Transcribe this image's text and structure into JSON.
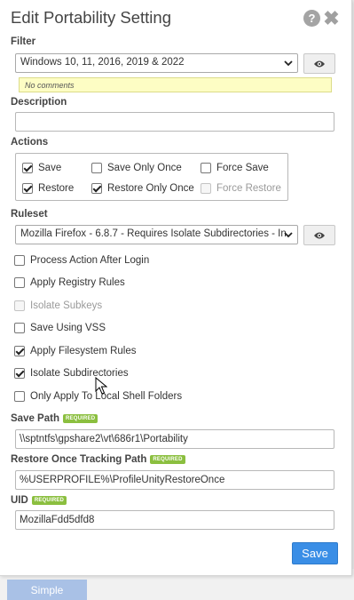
{
  "dialog": {
    "title": "Edit Portability Setting",
    "help_icon": "question-circle-icon",
    "close_icon": "close-icon",
    "help_glyph": "?",
    "close_glyph": "✖"
  },
  "filter": {
    "label": "Filter",
    "selected": "Windows 10, 11, 2016, 2019 & 2022",
    "comment": "No comments"
  },
  "description": {
    "label": "Description",
    "value": ""
  },
  "actions": {
    "label": "Actions",
    "items": [
      {
        "label": "Save",
        "checked": true,
        "disabled": false
      },
      {
        "label": "Save Only Once",
        "checked": false,
        "disabled": false
      },
      {
        "label": "Force Save",
        "checked": false,
        "disabled": false
      },
      {
        "label": "Restore",
        "checked": true,
        "disabled": false
      },
      {
        "label": "Restore Only Once",
        "checked": true,
        "disabled": false
      },
      {
        "label": "Force Restore",
        "checked": false,
        "disabled": true
      }
    ]
  },
  "ruleset": {
    "label": "Ruleset",
    "selected": "Mozilla Firefox - 6.8.7 - Requires Isolate Subdirectories - In"
  },
  "options": [
    {
      "label": "Process Action After Login",
      "checked": false,
      "disabled": false
    },
    {
      "label": "Apply Registry Rules",
      "checked": false,
      "disabled": false
    },
    {
      "label": "Isolate Subkeys",
      "checked": false,
      "disabled": true
    },
    {
      "label": "Save Using VSS",
      "checked": false,
      "disabled": false
    },
    {
      "label": "Apply Filesystem Rules",
      "checked": true,
      "disabled": false
    },
    {
      "label": "Isolate Subdirectories",
      "checked": true,
      "disabled": false
    },
    {
      "label": "Only Apply To Local Shell Folders",
      "checked": false,
      "disabled": false
    }
  ],
  "save_path": {
    "label": "Save Path",
    "badge": "REQUIRED",
    "value": "\\\\sptntfs\\gpshare2\\vt\\686r1\\Portability"
  },
  "restore_once": {
    "label": "Restore Once Tracking Path",
    "badge": "REQUIRED",
    "value": "%USERPROFILE%\\ProfileUnityRestoreOnce"
  },
  "uid": {
    "label": "UID",
    "badge": "REQUIRED",
    "value": "MozillaFdd5dfd8"
  },
  "footer": {
    "save_label": "Save"
  },
  "background": {
    "tab_label": "Simple"
  },
  "colors": {
    "primary_button": "#3a8ee6",
    "required_badge": "#8bbf3f",
    "comment_bg": "#fdfdc4"
  }
}
